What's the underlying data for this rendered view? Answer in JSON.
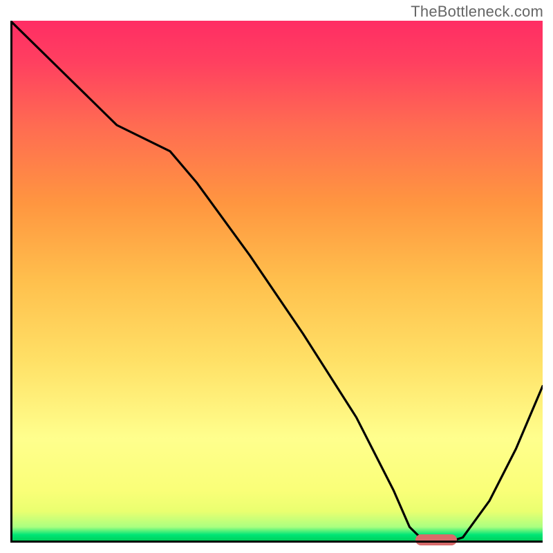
{
  "watermark": "TheBottleneck.com",
  "colors": {
    "curve": "#000000",
    "marker": "#d86a6a",
    "axis": "#000000",
    "gradient_top": "#ff2d64",
    "gradient_bottom": "#00c853"
  },
  "chart_data": {
    "type": "line",
    "title": "",
    "xlabel": "",
    "ylabel": "",
    "xlim": [
      0,
      100
    ],
    "ylim": [
      0,
      100
    ],
    "grid": false,
    "series": [
      {
        "name": "bottleneck-curve",
        "x": [
          0,
          10,
          20,
          30,
          35,
          45,
          55,
          65,
          72,
          75,
          78,
          82,
          85,
          90,
          95,
          100
        ],
        "values": [
          100,
          90,
          80,
          75,
          69,
          55,
          40,
          24,
          10,
          3,
          0,
          0,
          1,
          8,
          18,
          30
        ]
      }
    ],
    "annotations": [
      {
        "name": "optimal-marker",
        "x": 80,
        "y": 0.5,
        "color": "#d86a6a"
      }
    ]
  }
}
